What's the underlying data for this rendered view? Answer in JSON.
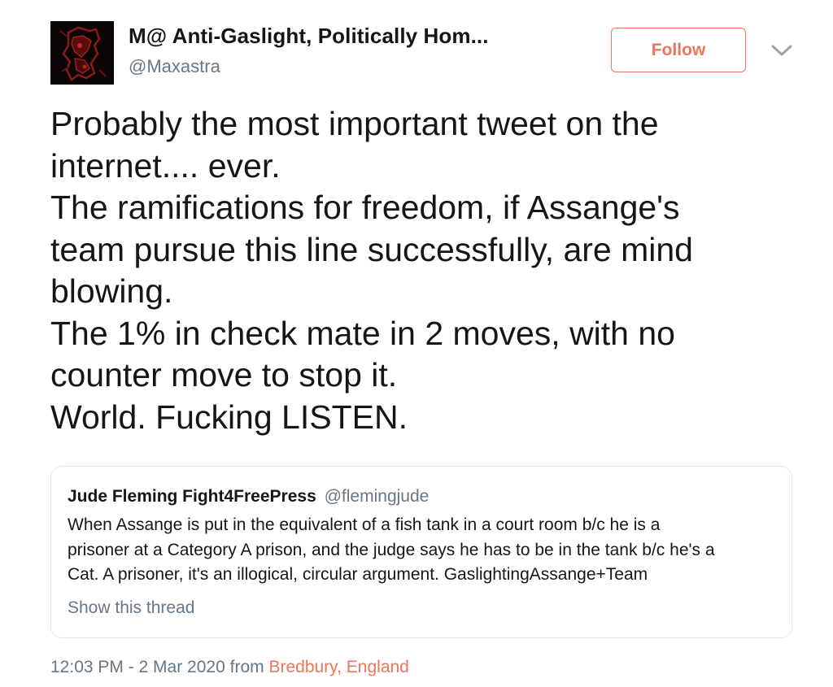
{
  "author": {
    "display_name": "M@ Anti-Gaslight, Politically Hom...",
    "handle": "@Maxastra"
  },
  "follow_label": "Follow",
  "tweet": {
    "text": "Probably the most important tweet on the\ninternet.... ever.\nThe ramifications for freedom, if Assange's\nteam pursue this line successfully, are mind\nblowing.\nThe 1% in check mate in 2 moves, with no\ncounter move to stop it.\nWorld. Fucking LISTEN."
  },
  "quoted_tweet": {
    "name": "Jude Fleming Fight4FreePress",
    "handle": "@flemingjude",
    "text": "When Assange is put in the equivalent of a fish tank in a court room b/c he is a\nprisoner at a Category A prison, and the judge says he has to be in the tank b/c he's a\nCat. A prisoner, it's an illogical, circular argument. GaslightingAssange+Team",
    "show_thread": "Show this thread"
  },
  "meta": {
    "timestamp": "12:03 PM - 2 Mar 2020",
    "from_label": "from",
    "location": "Bredbury, England"
  },
  "icons": {
    "avatar": "avatar-image",
    "caret": "chevron-down-icon"
  },
  "colors": {
    "accent": "#e8765a",
    "text": "#14171a",
    "secondary": "#657786",
    "border": "#e1e8ed"
  }
}
